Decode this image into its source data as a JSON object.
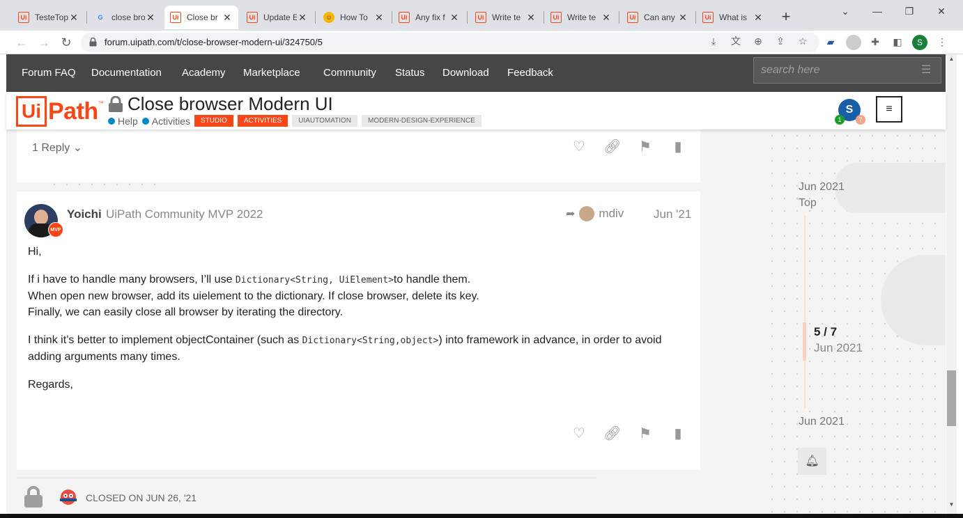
{
  "browser": {
    "tabs": [
      {
        "title": "TesteTop",
        "icon": "uipath-icon"
      },
      {
        "title": "close bro",
        "icon": "google-icon"
      },
      {
        "title": "Close br",
        "icon": "uipath-icon",
        "active": true
      },
      {
        "title": "Update E",
        "icon": "uipath-icon"
      },
      {
        "title": "How To",
        "icon": "howtogeek-icon"
      },
      {
        "title": "Any fix f",
        "icon": "uipath-icon"
      },
      {
        "title": "Write te",
        "icon": "uipath-icon"
      },
      {
        "title": "Write te",
        "icon": "uipath-icon"
      },
      {
        "title": "Can any",
        "icon": "uipath-icon"
      },
      {
        "title": "What is",
        "icon": "uipath-icon"
      }
    ],
    "new_tab": "+",
    "url": "forum.uipath.com/t/close-browser-modern-ui/324750/5",
    "profile_initial": "S"
  },
  "forum_nav": {
    "links": [
      "Forum FAQ",
      "Documentation",
      "Academy",
      "Marketplace",
      "Community",
      "Status",
      "Download",
      "Feedback"
    ],
    "search_placeholder": "search here"
  },
  "topic": {
    "logo_ui": "Ui",
    "logo_path": "Path",
    "logo_tm": "™",
    "title": "Close browser Modern UI",
    "categories": [
      "Help",
      "Activities"
    ],
    "tags_orange": [
      "STUDIO",
      "ACTIVITIES"
    ],
    "tags_gray": [
      "UIAUTOMATION",
      "MODERN-DESIGN-EXPERIENCE"
    ],
    "user_initial": "S",
    "badge_green": "1",
    "badge_orange": "7",
    "menu_icon": "≡"
  },
  "prev_post": {
    "reply_label": "1 Reply"
  },
  "post": {
    "username": "Yoichi",
    "user_title": "UiPath Community MVP 2022",
    "mvp": "MVP",
    "reply_to_user": "mdiv",
    "date": "Jun '21",
    "greeting": "Hi,",
    "p1_a": "If i have to handle many browsers, I’ll use ",
    "p1_code": "Dictionary<String, UiElement>",
    "p1_b": "to handle them.",
    "p1_line2": "When open new browser, add its uielement to the dictionary. If close browser, delete its key.",
    "p1_line3": "Finally, we can easily close all browser by iterating the directory.",
    "p2_a": "I think it’s better to implement objectContainer (such as ",
    "p2_code": "Dictionary<String,object>",
    "p2_b": ") into framework in advance, in order to avoid adding arguments many times.",
    "regards": "Regards,"
  },
  "closed": {
    "text": "Closed on Jun 26, '21"
  },
  "timeline": {
    "start_date": "Jun 2021",
    "top_label": "Top",
    "position": "5 / 7",
    "position_date": "Jun 2021",
    "end_date": "Jun 2021"
  },
  "colors": {
    "brand": "#fa4616",
    "nav_bg": "#464646",
    "category_dot": "#0088cc"
  }
}
